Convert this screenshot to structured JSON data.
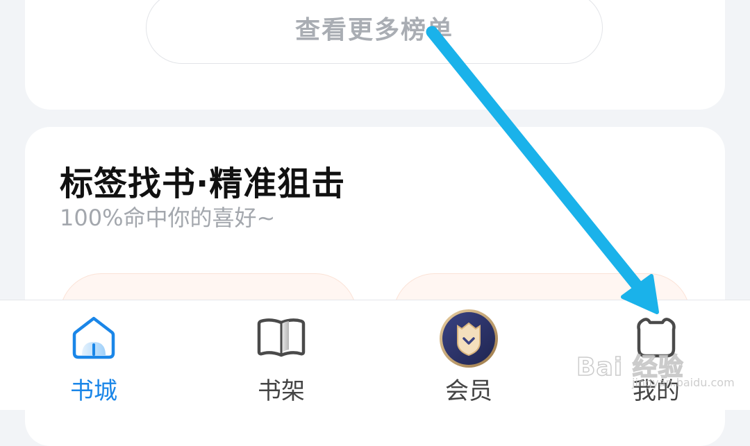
{
  "ranking": {
    "more_label": "查看更多榜单"
  },
  "tag_section": {
    "title": "标签找书·精准狙击",
    "subtitle": "100%命中你的喜好~"
  },
  "tabbar": {
    "tabs": [
      {
        "label": "书城",
        "icon": "home-icon",
        "active": true
      },
      {
        "label": "书架",
        "icon": "book-icon",
        "active": false
      },
      {
        "label": "会员",
        "icon": "vip-shield-icon",
        "active": false
      },
      {
        "label": "我的",
        "icon": "bear-profile-icon",
        "active": false
      }
    ]
  },
  "annotation": {
    "arrow_color": "#1ab2ea"
  },
  "watermark": {
    "brand": "Bai  经验",
    "url": "jingyan.baidu.com"
  },
  "colors": {
    "accent": "#1a86e8",
    "vip_dark": "#2d3364",
    "vip_gold": "#c7a06a"
  }
}
